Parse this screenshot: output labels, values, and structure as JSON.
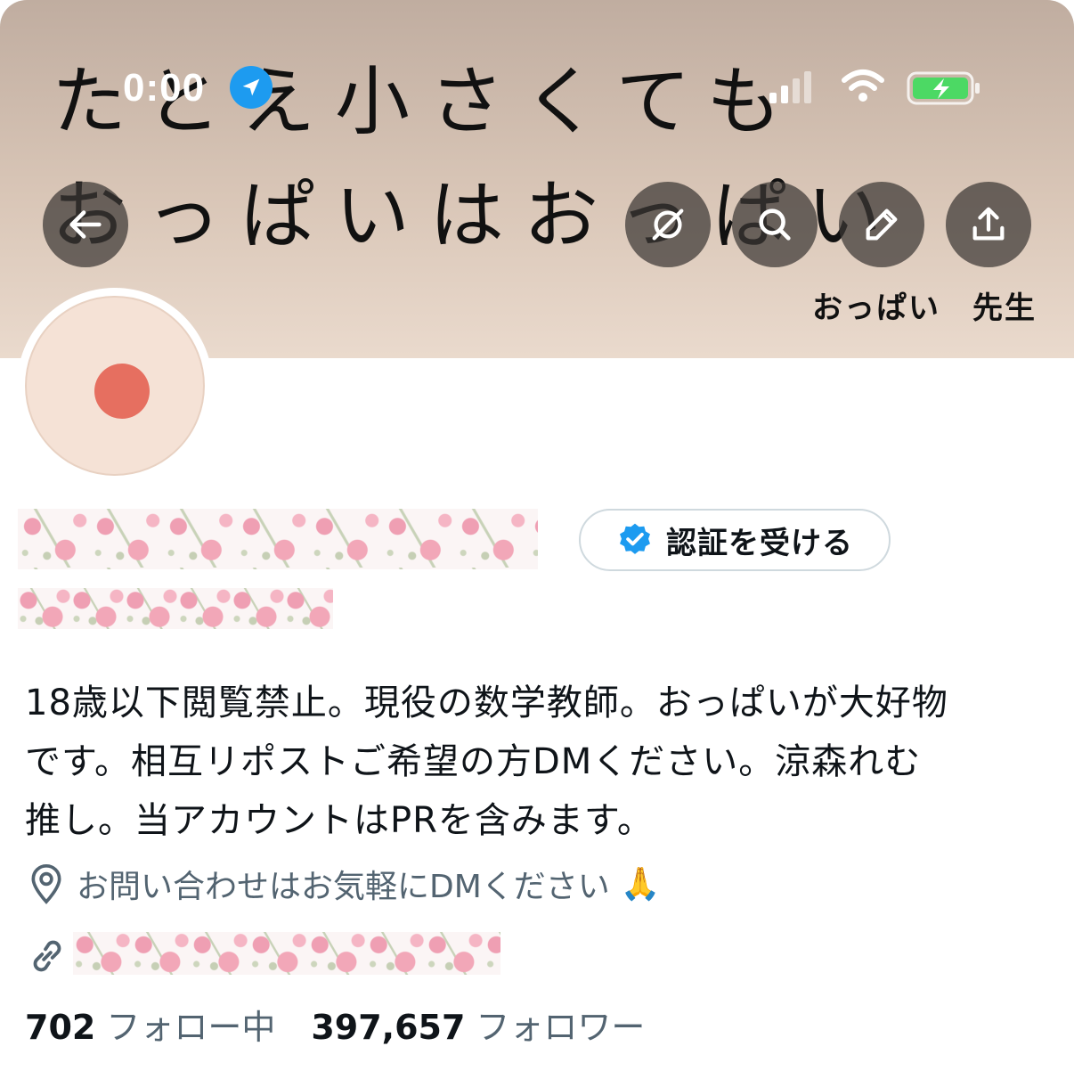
{
  "status_bar": {
    "time": "0:00"
  },
  "banner": {
    "line1": "たとえ小さくても",
    "line2": "おっぱいはおっぱい",
    "caption": "おっぱい　先生"
  },
  "header_buttons": {
    "back_icon": "arrow-left-icon",
    "grok_icon": "grok-icon",
    "search_icon": "search-icon",
    "edit_icon": "pencil-icon",
    "share_icon": "share-icon"
  },
  "profile": {
    "verify_button_label": "認証を受ける",
    "bio_lines": [
      "18歳以下閲覧禁止。現役の数学教師。おっぱいが大好物",
      "です。相互リポストご希望の方DMください。涼森れむ",
      "推し。当アカウントはPRを含みます。"
    ],
    "location": "お問い合わせはお気軽にDMください",
    "location_emoji": "🙏",
    "following_count": "702",
    "following_label": "フォロー中",
    "followers_count": "397,657",
    "followers_label": "フォロワー"
  },
  "colors": {
    "accent_blue": "#1d9bf0",
    "avatar_dot": "#e66f60",
    "muted_text": "#536471"
  }
}
